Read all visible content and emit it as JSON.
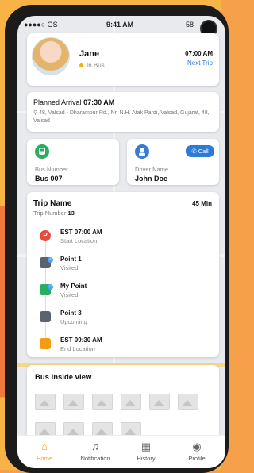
{
  "status": {
    "carrier": "●●●●○ GS",
    "time": "9:41 AM",
    "battery": "58"
  },
  "profile": {
    "name": "Jane",
    "status": "In Bus",
    "time": "07:00 AM",
    "next_trip": "Next Trip"
  },
  "arrival": {
    "label": "Planned Arrival",
    "time": "07:30 AM",
    "address": "48, Valsad - Dharampur Rd., Nr. N.H. Atak Pardi, Valsad, Gujarat, 48, Valsad"
  },
  "bus": {
    "label": "Bus Number",
    "value": "Bus 007"
  },
  "driver": {
    "label": "Driver Name",
    "value": "John Doe",
    "call": "Call"
  },
  "trip": {
    "title": "Trip Name",
    "number_label": "Trip Number",
    "number": "13",
    "duration": "45 Min",
    "stops": [
      {
        "title": "EST 07:00 AM",
        "sub": "Start Location",
        "color": "#e84b3c",
        "icon": "P"
      },
      {
        "title": "Point 1",
        "sub": "Visited",
        "color": "#5b6270",
        "icon": "bus"
      },
      {
        "title": "My Point",
        "sub": "Visited",
        "color": "#27ae60",
        "icon": "bus"
      },
      {
        "title": "Point 3",
        "sub": "Upcoming",
        "color": "#5b6270",
        "icon": "bus"
      },
      {
        "title": "EST 09:30 AM",
        "sub": "End Location",
        "color": "#f39c12",
        "icon": "flag"
      }
    ]
  },
  "bus_inside": {
    "title": "Bus inside view"
  },
  "tabs": [
    {
      "label": "Home",
      "icon": "home-icon",
      "active": true
    },
    {
      "label": "Notification",
      "icon": "bell-icon",
      "active": false
    },
    {
      "label": "History",
      "icon": "calendar-icon",
      "active": false
    },
    {
      "label": "Profile",
      "icon": "user-icon",
      "active": false
    }
  ],
  "colors": {
    "accent": "#f3a318",
    "link": "#2d7bd8",
    "bus": "#27ae60",
    "driver": "#3a7bd5"
  }
}
